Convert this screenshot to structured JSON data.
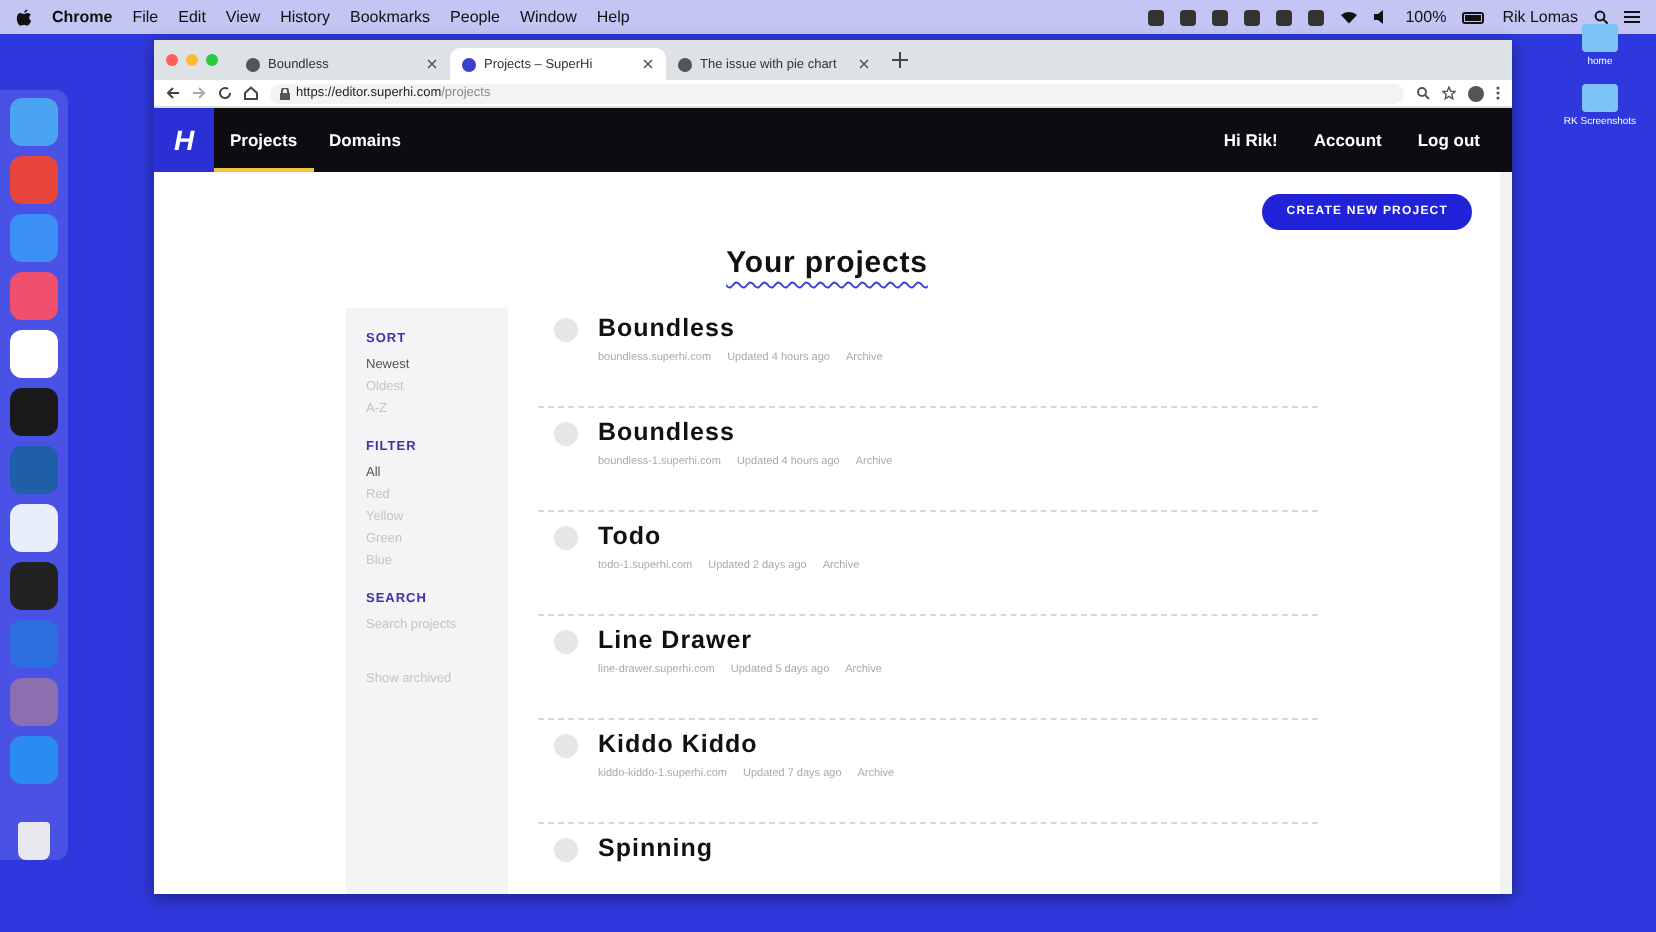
{
  "menubar": {
    "app": "Chrome",
    "menus": [
      "File",
      "Edit",
      "View",
      "History",
      "Bookmarks",
      "People",
      "Window",
      "Help"
    ],
    "battery": "100%",
    "user": "Rik Lomas"
  },
  "desktop_icons": [
    {
      "label": "home"
    },
    {
      "label": "RK Screenshots"
    }
  ],
  "browser": {
    "tabs": [
      {
        "title": "Boundless",
        "selected": false
      },
      {
        "title": "Projects – SuperHi",
        "selected": true
      },
      {
        "title": "The issue with pie chart",
        "selected": false
      }
    ],
    "url": {
      "host": "https://editor.superhi.com",
      "path": "/projects"
    }
  },
  "navbar": {
    "logo": "H",
    "links": [
      {
        "label": "Projects",
        "selected": true
      },
      {
        "label": "Domains",
        "selected": false
      }
    ],
    "right_links": [
      "Hi Rik!",
      "Account",
      "Log out"
    ]
  },
  "create_button": "CREATE NEW PROJECT",
  "title": "Your projects",
  "sidebar": {
    "sections": [
      {
        "heading": "SORT",
        "kind": "options",
        "items": [
          {
            "label": "Newest",
            "selected": true
          },
          {
            "label": "Oldest",
            "selected": false
          },
          {
            "label": "A-Z",
            "selected": false
          }
        ]
      },
      {
        "heading": "FILTER",
        "kind": "options",
        "items": [
          {
            "label": "All",
            "selected": true
          },
          {
            "label": "Red",
            "selected": false
          },
          {
            "label": "Yellow",
            "selected": false
          },
          {
            "label": "Green",
            "selected": false
          },
          {
            "label": "Blue",
            "selected": false
          }
        ]
      },
      {
        "heading": "SEARCH",
        "kind": "search",
        "placeholder": "Search projects"
      }
    ],
    "show_archived": "Show archived"
  },
  "projects": [
    {
      "name": "Boundless",
      "url": "boundless.superhi.com",
      "updated": "Updated 4 hours ago",
      "action": "Archive"
    },
    {
      "name": "Boundless",
      "url": "boundless-1.superhi.com",
      "updated": "Updated 4 hours ago",
      "action": "Archive"
    },
    {
      "name": "Todo",
      "url": "todo-1.superhi.com",
      "updated": "Updated 2 days ago",
      "action": "Archive"
    },
    {
      "name": "Line Drawer",
      "url": "line-drawer.superhi.com",
      "updated": "Updated 5 days ago",
      "action": "Archive"
    },
    {
      "name": "Kiddo Kiddo",
      "url": "kiddo-kiddo-1.superhi.com",
      "updated": "Updated 7 days ago",
      "action": "Archive"
    },
    {
      "name": "Spinning"
    }
  ]
}
